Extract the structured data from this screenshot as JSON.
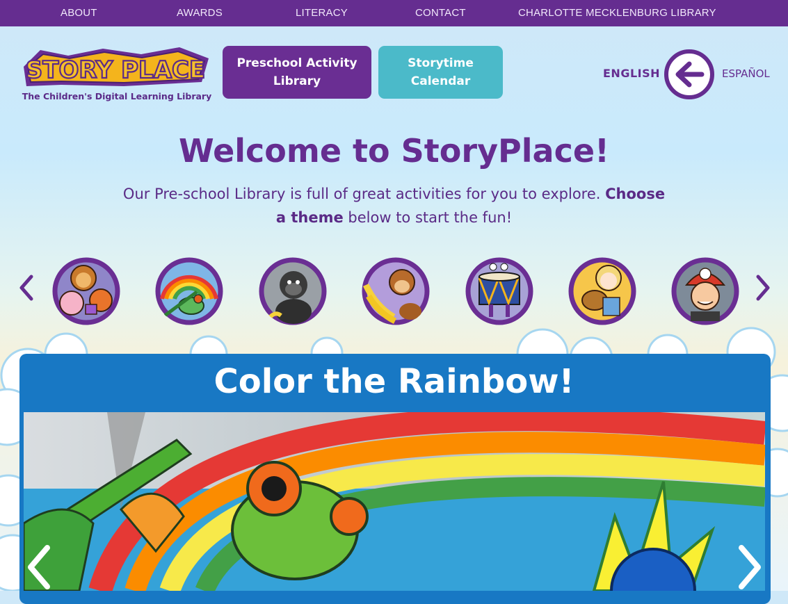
{
  "topnav": {
    "items": [
      {
        "label": "ABOUT"
      },
      {
        "label": "AWARDS"
      },
      {
        "label": "LITERACY"
      },
      {
        "label": "CONTACT"
      },
      {
        "label": "CHARLOTTE MECKLENBURG LIBRARY"
      }
    ]
  },
  "logo": {
    "wordmark": "STORY PLACE",
    "tagline": "The Children's Digital Learning Library"
  },
  "header": {
    "preschool_button": "Preschool Activity Library",
    "preschool_line1": "Preschool Activity",
    "preschool_line2": "Library",
    "storytime_button": "Storytime Calendar",
    "storytime_line1": "Storytime",
    "storytime_line2": "Calendar",
    "lang_english": "ENGLISH",
    "lang_spanish": "ESPAÑOL"
  },
  "welcome": {
    "title": "Welcome to StoryPlace!",
    "intro_part1": "Our Pre-school Library is full of great activities for you to explore. ",
    "intro_bold": "Choose a theme",
    "intro_part2": " below to start the fun!"
  },
  "themes": {
    "items": [
      {
        "icon": "animal-friends-icon"
      },
      {
        "icon": "rainbow-frog-icon"
      },
      {
        "icon": "gorilla-icon"
      },
      {
        "icon": "monkey-bananas-icon"
      },
      {
        "icon": "drum-icon"
      },
      {
        "icon": "girl-with-dog-icon"
      },
      {
        "icon": "firefighter-icon"
      }
    ]
  },
  "feature": {
    "title": "Color the Rainbow!"
  },
  "colors": {
    "purple": "#652d90",
    "teal": "#4bbac9",
    "feature_blue": "#1878c4"
  }
}
